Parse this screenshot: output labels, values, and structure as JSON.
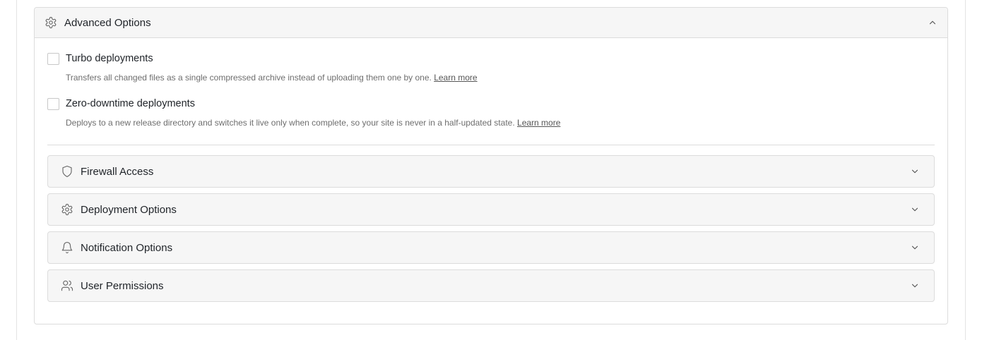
{
  "advanced": {
    "title": "Advanced Options",
    "icon": "gear-icon",
    "expanded": true,
    "options": [
      {
        "label": "Turbo deployments",
        "checked": false,
        "description": "Transfers all changed files as a single compressed archive instead of uploading them one by one.",
        "link": "Learn more"
      },
      {
        "label": "Zero-downtime deployments",
        "checked": false,
        "description": "Deploys to a new release directory and switches it live only when complete, so your site is never in a half-updated state.",
        "link": "Learn more"
      }
    ]
  },
  "sections": [
    {
      "title": "Firewall Access",
      "icon": "shield-icon",
      "expanded": false
    },
    {
      "title": "Deployment Options",
      "icon": "gear-icon",
      "expanded": false
    },
    {
      "title": "Notification Options",
      "icon": "bell-icon",
      "expanded": false
    },
    {
      "title": "User Permissions",
      "icon": "users-icon",
      "expanded": false
    }
  ]
}
